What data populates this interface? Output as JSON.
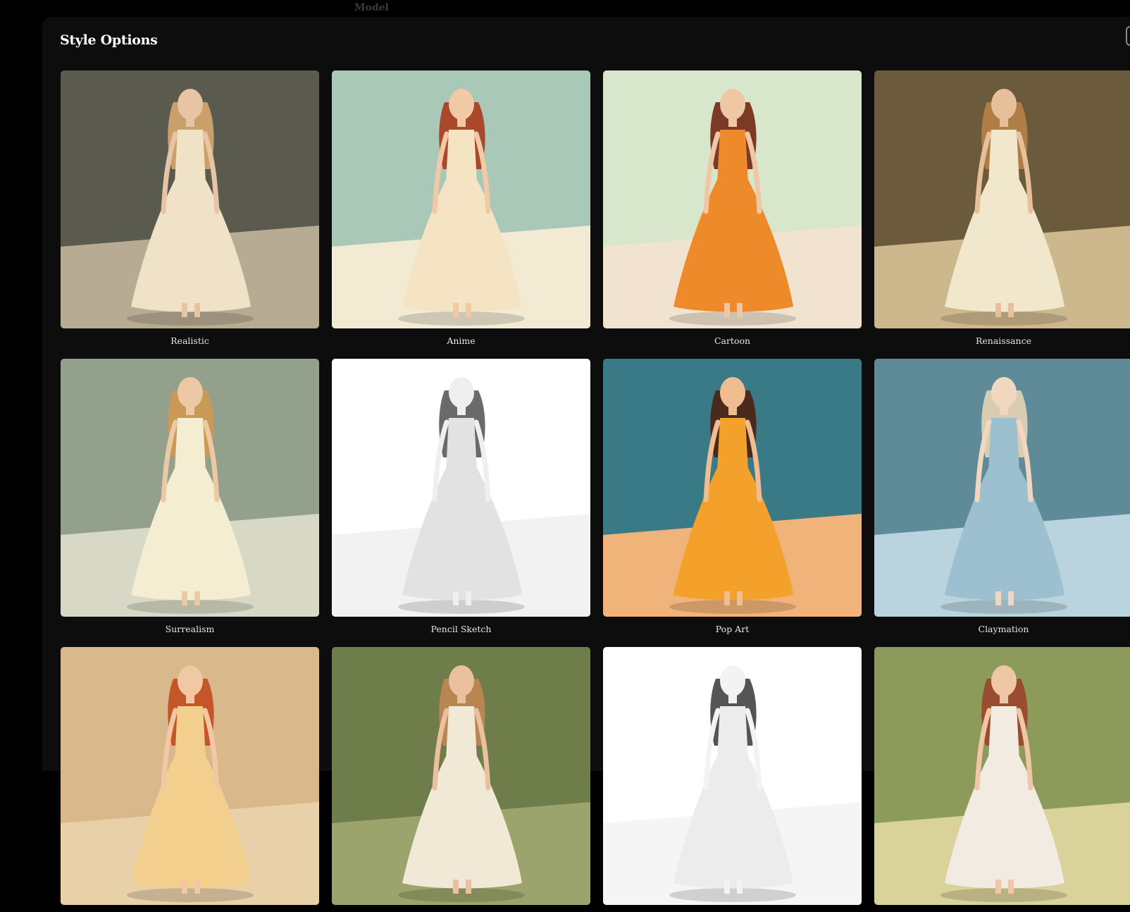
{
  "app": {
    "top_label": "Model"
  },
  "modal": {
    "title": "Style Options"
  },
  "styles": [
    {
      "label": "Realistic",
      "bg": "#5b5a4e",
      "floor": "#b8ab93",
      "dress": "#efe2c6",
      "hair": "#c9a06a",
      "skin": "#e8c4a6",
      "icon": "image-icon"
    },
    {
      "label": "Anime",
      "bg": "#a9c8b8",
      "floor": "#f3ead3",
      "dress": "#f5e4c4",
      "hair": "#a9482a",
      "skin": "#f2c9a6",
      "icon": "image-icon"
    },
    {
      "label": "Cartoon",
      "bg": "#d8e7cc",
      "floor": "#f1e3cf",
      "dress": "#ee8a2a",
      "hair": "#7a3a26",
      "skin": "#f0c7a5",
      "icon": "image-icon"
    },
    {
      "label": "Renaissance",
      "bg": "#6b5a3c",
      "floor": "#cdb88e",
      "dress": "#f1e7cd",
      "hair": "#b07d44",
      "skin": "#e6c09b",
      "icon": "image-icon"
    },
    {
      "label": "Surrealism",
      "bg": "#93a08c",
      "floor": "#d7d9c6",
      "dress": "#f4edd2",
      "hair": "#c99a55",
      "skin": "#edc8a4",
      "icon": "image-icon"
    },
    {
      "label": "Pencil Sketch",
      "bg": "#ffffff",
      "floor": "#f2f2f2",
      "dress": "#e2e2e2",
      "hair": "#6a6a6a",
      "skin": "#efefef",
      "icon": "image-icon"
    },
    {
      "label": "Pop Art",
      "bg": "#3a7a86",
      "floor": "#f0b37a",
      "dress": "#f4a12b",
      "hair": "#4a2a1c",
      "skin": "#f0bd91",
      "icon": "image-icon"
    },
    {
      "label": "Claymation",
      "bg": "#5f8a98",
      "floor": "#b9d4df",
      "dress": "#9cc0cf",
      "hair": "#d8cdb3",
      "skin": "#f1d7c0",
      "icon": "image-icon"
    },
    {
      "label": "",
      "bg": "#d9b98c",
      "floor": "#e8d1a8",
      "dress": "#f3cf8e",
      "hair": "#c5562a",
      "skin": "#f2c7a4",
      "icon": "image-icon"
    },
    {
      "label": "",
      "bg": "#6f7d4a",
      "floor": "#9aa46c",
      "dress": "#f2e8d6",
      "hair": "#b98550",
      "skin": "#e9c19f",
      "icon": "image-icon"
    },
    {
      "label": "",
      "bg": "#ffffff",
      "floor": "#f5f5f5",
      "dress": "#ececec",
      "hair": "#555555",
      "skin": "#f3f3f3",
      "icon": "image-icon"
    },
    {
      "label": "",
      "bg": "#8c9a5a",
      "floor": "#d9d29a",
      "dress": "#f1ebe2",
      "hair": "#9a4c30",
      "skin": "#efc6a6",
      "icon": "image-icon"
    }
  ]
}
